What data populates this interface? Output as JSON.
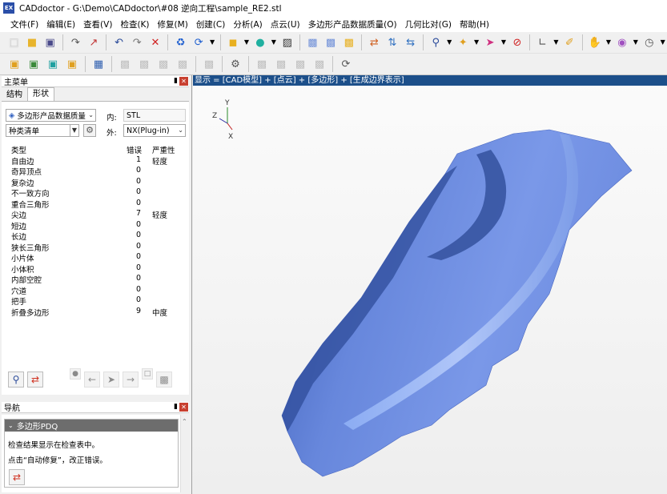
{
  "window": {
    "app_icon_text": "EX",
    "title": "CADdoctor - G:\\Demo\\CADdoctor\\#08 逆向工程\\sample_RE2.stl"
  },
  "menu": [
    "文件(F)",
    "编辑(E)",
    "查看(V)",
    "检查(K)",
    "修复(M)",
    "创建(C)",
    "分析(A)",
    "点云(U)",
    "多边形产品数据质量(O)",
    "几何比对(G)",
    "帮助(H)"
  ],
  "toolbar_icons": {
    "row1": [
      "new-file",
      "open-folder",
      "save",
      "import",
      "export",
      "undo",
      "redo",
      "delete",
      "auto-repair",
      "rotate",
      "box",
      "sphere",
      "scale",
      "cube-a",
      "cube-b",
      "cube-c",
      "swap-a",
      "swap-b",
      "swap-c",
      "magnify",
      "pointer",
      "pin",
      "stop",
      "axis",
      "brush",
      "hand",
      "eye",
      "clock"
    ],
    "row2": [
      "view-a",
      "view-b",
      "view-c",
      "view-d",
      "layout",
      "mesh-a",
      "mesh-b",
      "mesh-c",
      "mesh-d",
      "mesh-e",
      "settings",
      "tool-a",
      "tool-b",
      "tool-c",
      "tool-d",
      "refresh"
    ]
  },
  "main_panel": {
    "title": "主菜单",
    "tabs": [
      "结构",
      "形状"
    ],
    "active_tab": 1,
    "category_select": "多边形产品数据质量",
    "in_label": "内:",
    "in_value": "STL",
    "list_select": "种类清单",
    "out_label": "外:",
    "out_value": "NX(Plug-in)",
    "columns": {
      "type": "类型",
      "errors": "错误",
      "severity": "严重性"
    },
    "rows": [
      {
        "type": "自由边",
        "count": "1",
        "severity": "轻度"
      },
      {
        "type": "奇异顶点",
        "count": "0",
        "severity": ""
      },
      {
        "type": "复杂边",
        "count": "0",
        "severity": ""
      },
      {
        "type": "不一致方向",
        "count": "0",
        "severity": ""
      },
      {
        "type": "重合三角形",
        "count": "0",
        "severity": ""
      },
      {
        "type": "尖边",
        "count": "7",
        "severity": "轻度"
      },
      {
        "type": "短边",
        "count": "0",
        "severity": ""
      },
      {
        "type": "长边",
        "count": "0",
        "severity": ""
      },
      {
        "type": "狭长三角形",
        "count": "0",
        "severity": ""
      },
      {
        "type": "小片体",
        "count": "0",
        "severity": ""
      },
      {
        "type": "小体积",
        "count": "0",
        "severity": ""
      },
      {
        "type": "内部空腔",
        "count": "0",
        "severity": ""
      },
      {
        "type": "穴道",
        "count": "0",
        "severity": ""
      },
      {
        "type": "把手",
        "count": "0",
        "severity": ""
      },
      {
        "type": "折叠多边形",
        "count": "9",
        "severity": "中度"
      }
    ]
  },
  "nav_panel": {
    "title": "导航",
    "section_title": "多边形PDQ",
    "line1": "检查结果显示在检查表中。",
    "line2": "点击“自动修复”，改正错误。"
  },
  "viewport": {
    "header": "显示 = [CAD模型] + [点云] + [多边形] + [生成边界表示]",
    "axis_x": "X",
    "axis_y": "Y",
    "axis_z": "Z",
    "model_color": "#6f8fe0"
  },
  "colors": {
    "viewport_header_bg": "#1c4f8a",
    "close_red": "#c84030"
  }
}
